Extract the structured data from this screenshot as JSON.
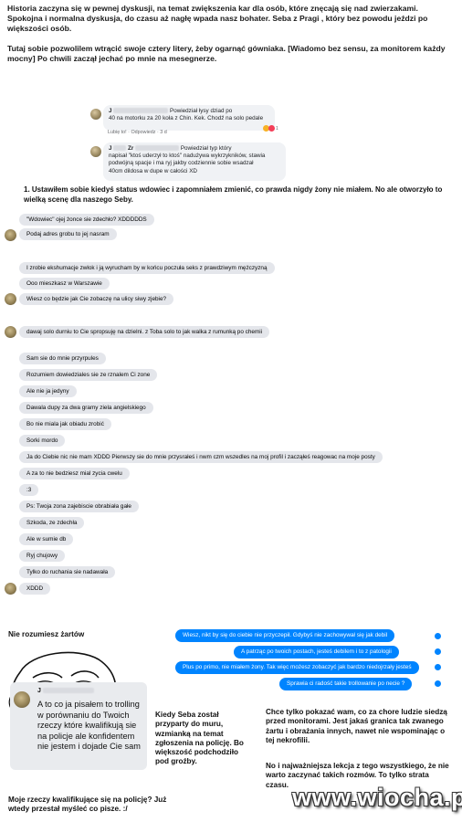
{
  "intro": {
    "paragraph1": "Historia zaczyna się w pewnej dyskusji, na temat zwiększenia kar dla osób, które znęcają się nad zwierzakami. Spokojna i normalna dyskusja, do czasu aż nagłę wpada nasz bohater. Seba z Pragi , który bez powodu jeździ po większości osób.",
    "paragraph2": "Tutaj sobie pozwolilem wtrącić swoje cztery litery, żeby ogarnąć gówniaka. [Wiadomo bez sensu, za monitorem każdy mocny] Po chwili zaczął jechać po mnie na mesegnerze."
  },
  "fb_comment1": {
    "name": "J",
    "text_line1": "Powiedział łysy dziad po",
    "text_line2": "40 na motorku za 20 koła z Chin. Kek. Chodź na solo pedale",
    "like": "Lubię to!",
    "reply": "Odpowiedz",
    "time": "3 d",
    "reaction_count": "1"
  },
  "fb_comment2": {
    "name": "J",
    "name2": "Zr",
    "text_line1": "Powiedział typ który",
    "text_line2": "napisał \"ktoś uderzył to ktoś\" nadużywa wykrzykników, stawia",
    "text_line3": "podwójną spacje i ma ryj jakby codziennie sobie wsadzał",
    "text_line4": "40cm dildosa w dupe w całości XD"
  },
  "step1": "1. Ustawiłem sobie kiedyś status wdowiec i zapomniałem zmienić, co prawda nigdy żony nie miałem. No ale otworzyło to wielką scenę dla naszego Seby.",
  "messages": [
    "\"Wdowiec\" ojej żonce sie zdechło? XDDDDDS",
    "Podaj adres grobu to jej nasram",
    "I zrobie ekshumacje zwłok i ją wyrucham by w końcu poczuła seks z prawdziwym mężczyzną",
    "Ooo mieszkasz w Warszawie",
    "Wiesz co będzie jak Cie zobaczę na ulicy siwy zjebie?",
    "dawaj solo durniu to Cie spropsuję na dzielni. z Toba solo to jak walka z rumunką po chemii",
    "Sam sie do mnie przyrpules",
    "Rozumiem dowiedziales sie ze rznalem Ci zone",
    "Ale nie ja jedyny",
    "Dawala dupy za dwa gramy ziela angielskiego",
    "Bo nie miala jak obiadu zrobić",
    "Sorki mordo",
    "Ja do Ciebie nic nie mam XDDD Pierwszy sie do mnie przysrałeś i nwm czm wszedles na moj profil i zacząłeś reagowac na moje posty",
    "A za to nie bedziesz mial zycia cwelu",
    ":3",
    "Ps: Twoja zona zajebiscie obrabiała gałe",
    "Szkoda, ze zdechła",
    "Ale w sumie db",
    "Ryj chujowy",
    "Tylko do ruchania sie nadawała",
    "XDDD"
  ],
  "troll_caption": "Nie rozumiesz żartów",
  "my_messages": [
    "Wiesz, nikt by się do ciebie nie przyczepił. Gdybyś nie zachowywał się jak debil",
    "A patrząc po twoich postach, jesteś debilem i to z patologii",
    "Plus po primo, nie miałem żony. Tak więc możesz zobaczyć jak bardzo niedojrzały jesteś",
    "Sprawia ci radość takie trollowanie po necie ?"
  ],
  "big_comment": {
    "name": "J",
    "text": "A to co ja pisałem to trolling w porównaniu do Twoich rzeczy które kwalifikują sie na policje ale konfidentem nie jestem i dojade Cie sam"
  },
  "bottom_caption": "Moje rzeczy kwalifikujące się na policję? Już wtedy przestał myśleć co pisze. :/",
  "middle_caption": "Kiedy Seba został przyparty do muru, wzmianką na temat zgłoszenia na policję. Bo większość podchodziło pod groźby.",
  "right_caption1": "Chce tylko pokazać wam, co za chore ludzie siedzą przed monitorami. Jest jakaś granica tak zwanego żartu i obrażania innych, nawet nie wspominając o tej nekrofilii.",
  "right_caption2": "No i najważniejsza lekcja z tego wszystkiego, że nie warto zaczynać takich rozmów. To tylko strata czasu.",
  "watermark": "www.wiocha.pl",
  "colors": {
    "messenger_blue": "#0084ff",
    "bubble_gray": "#e4e6eb",
    "fb_card": "#f0f2f5"
  }
}
